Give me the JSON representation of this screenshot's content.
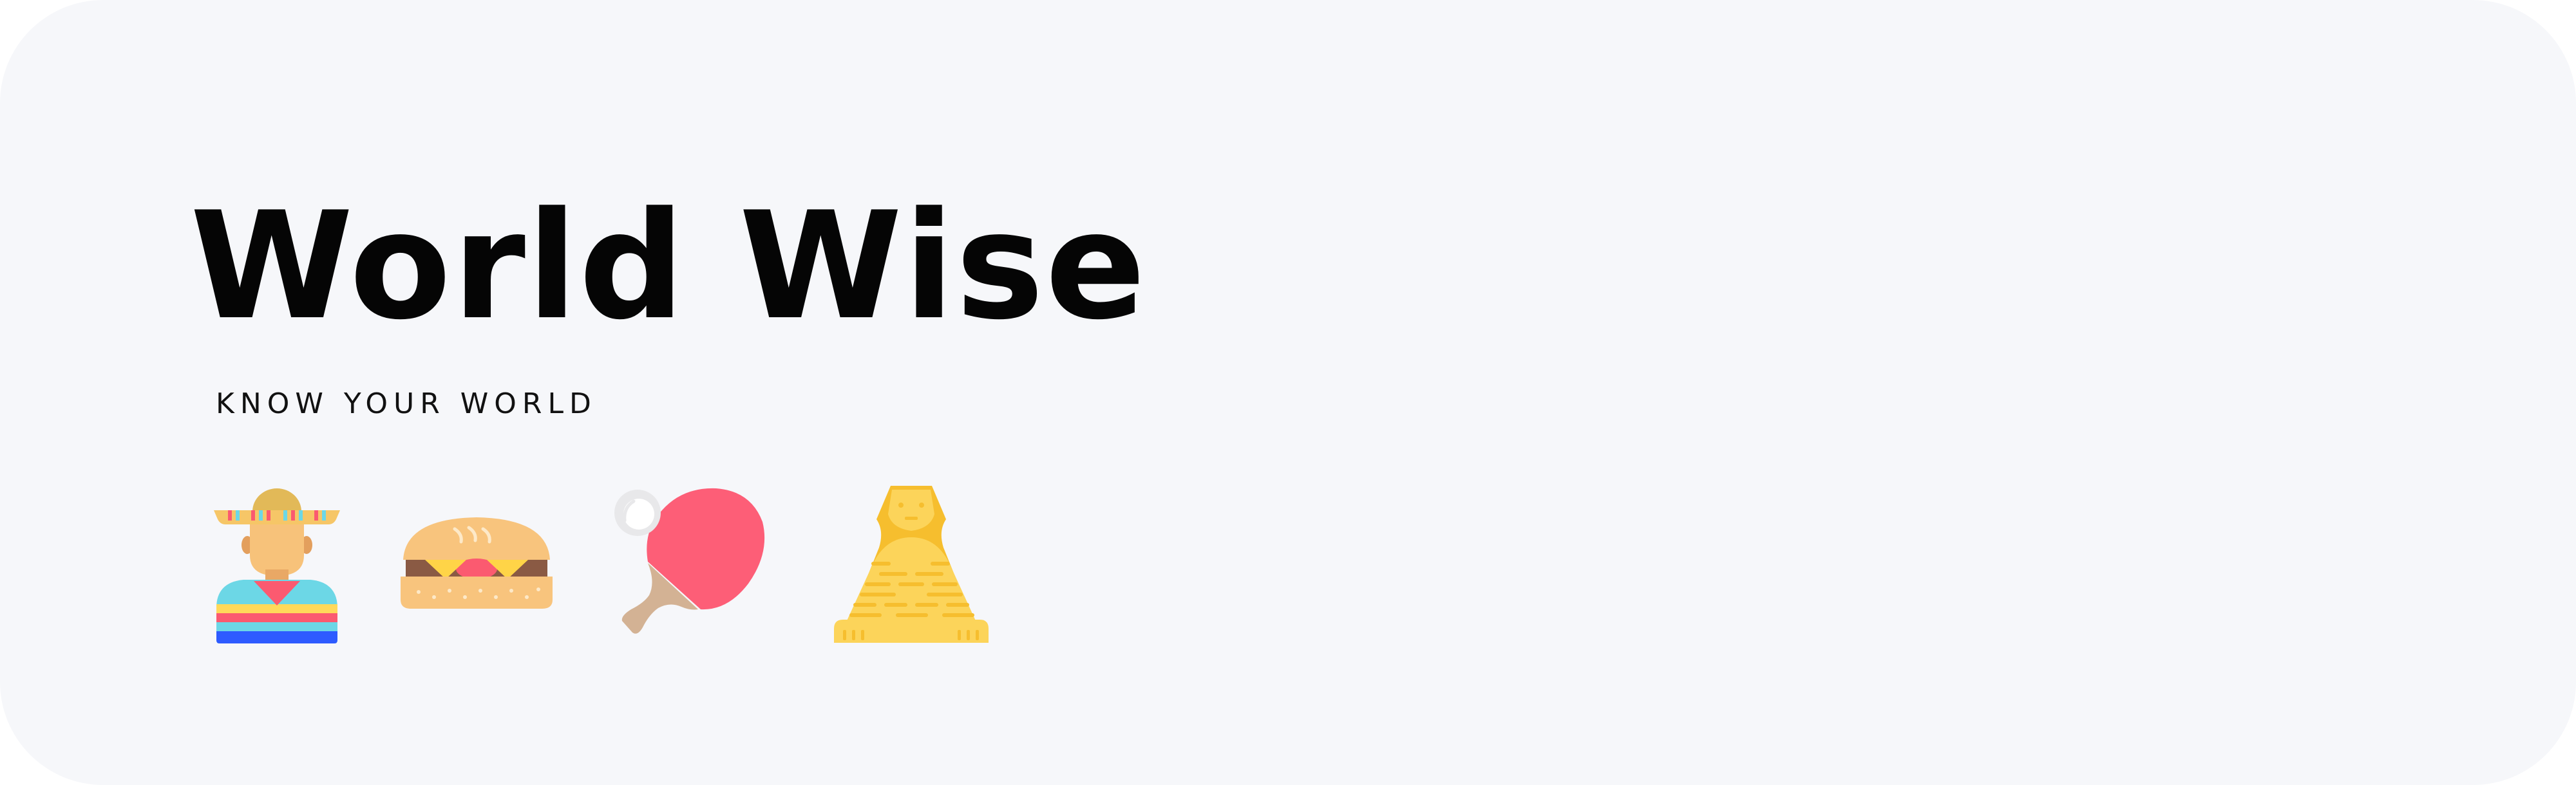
{
  "brand": {
    "title": "World Wise",
    "tagline": "KNOW YOUR WORLD"
  },
  "icons": [
    {
      "name": "mexican-man-sombrero-icon"
    },
    {
      "name": "sandwich-icon"
    },
    {
      "name": "ping-pong-paddle-icon"
    },
    {
      "name": "sphinx-icon"
    }
  ],
  "colors": {
    "background": "#f6f7fa",
    "title": "#050505",
    "sombrero": "#f6c667",
    "skin": "#f7c27a",
    "poncho_red": "#fb5a70",
    "poncho_blue": "#2e5bff",
    "paddle_red": "#fd5e77",
    "paddle_handle": "#d3b294",
    "sphinx_yellow": "#fcd45a"
  }
}
